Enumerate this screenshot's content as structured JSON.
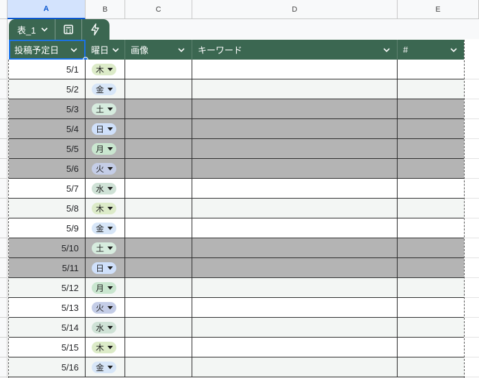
{
  "columns": [
    "A",
    "B",
    "C",
    "D",
    "E"
  ],
  "table": {
    "name": "表_1",
    "header": [
      "投稿予定日",
      "曜日",
      "画像",
      "キーワード",
      "#"
    ]
  },
  "colors": {
    "header_green": "#3b6751",
    "weekend_gray": "#b4b4b4",
    "selection_blue": "#1a73e8"
  },
  "day_chip_colors": {
    "木": "#dcebc8",
    "金": "#d7e6f8",
    "土": "#d6ecde",
    "日": "#cfe0fb",
    "月": "#c9e6cf",
    "火": "#c4cde7",
    "水": "#cfe2d6"
  },
  "rows": [
    {
      "date": "5/1",
      "day": "木",
      "weekend": false
    },
    {
      "date": "5/2",
      "day": "金",
      "weekend": false
    },
    {
      "date": "5/3",
      "day": "土",
      "weekend": true
    },
    {
      "date": "5/4",
      "day": "日",
      "weekend": true
    },
    {
      "date": "5/5",
      "day": "月",
      "weekend": true
    },
    {
      "date": "5/6",
      "day": "火",
      "weekend": true
    },
    {
      "date": "5/7",
      "day": "水",
      "weekend": false
    },
    {
      "date": "5/8",
      "day": "木",
      "weekend": false
    },
    {
      "date": "5/9",
      "day": "金",
      "weekend": false
    },
    {
      "date": "5/10",
      "day": "土",
      "weekend": true
    },
    {
      "date": "5/11",
      "day": "日",
      "weekend": true
    },
    {
      "date": "5/12",
      "day": "月",
      "weekend": false
    },
    {
      "date": "5/13",
      "day": "火",
      "weekend": false
    },
    {
      "date": "5/14",
      "day": "水",
      "weekend": false
    },
    {
      "date": "5/15",
      "day": "木",
      "weekend": false
    },
    {
      "date": "5/16",
      "day": "金",
      "weekend": false
    }
  ]
}
